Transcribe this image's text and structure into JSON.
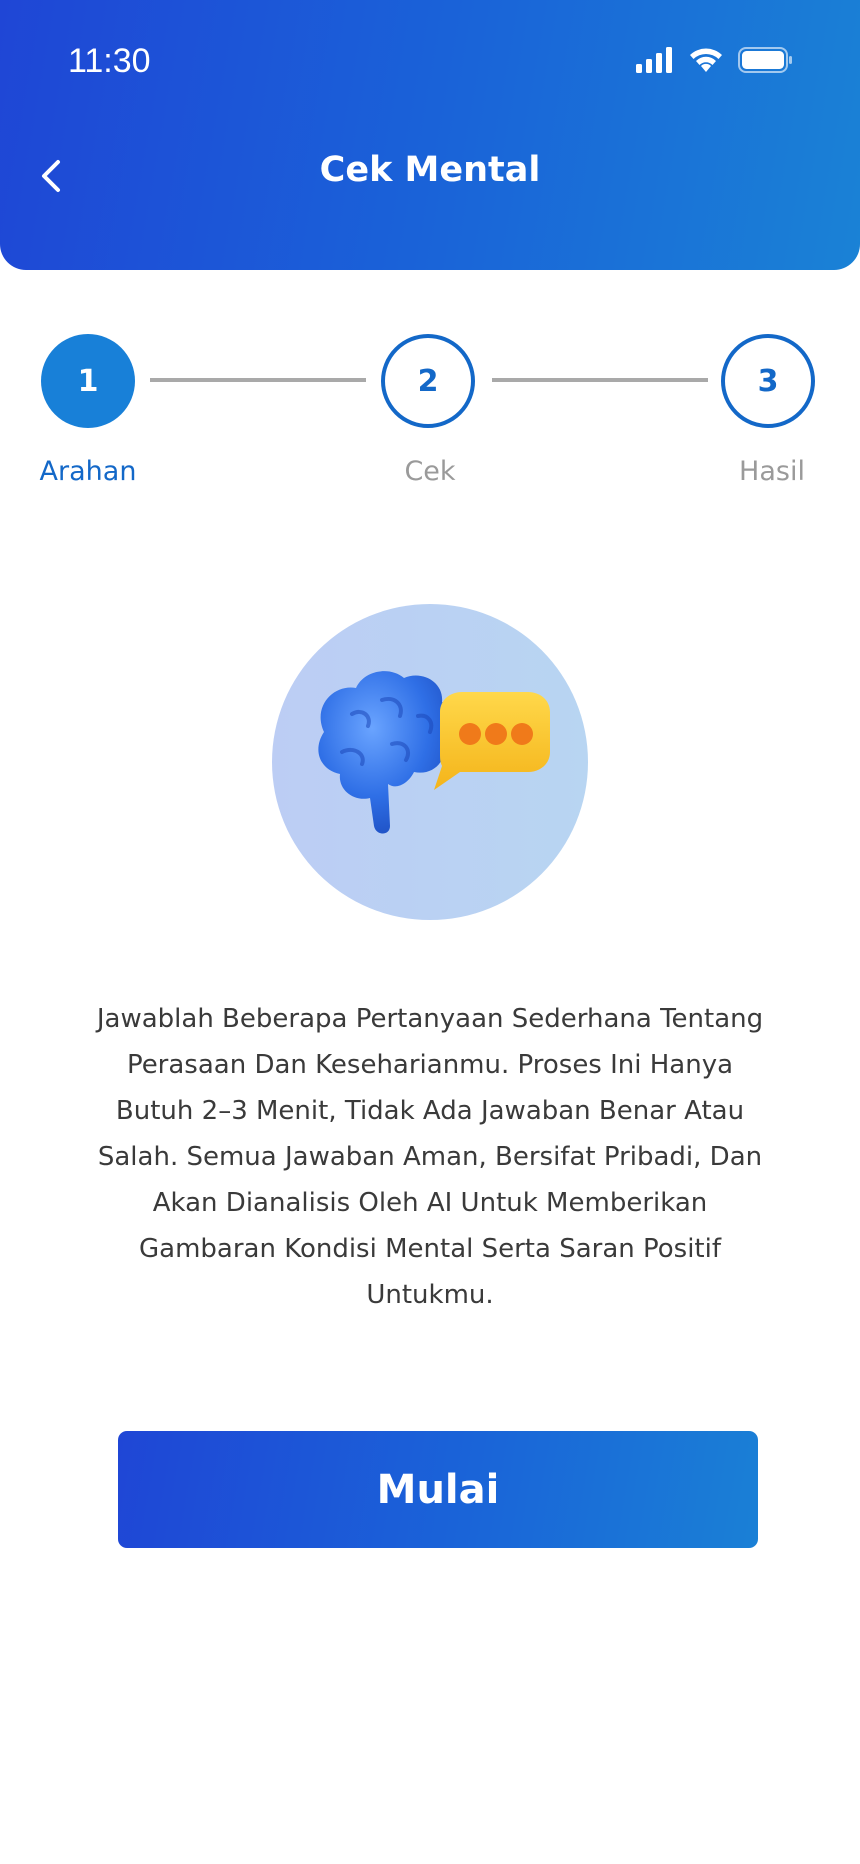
{
  "status_bar": {
    "time": "11:30"
  },
  "header": {
    "title": "Cek Mental"
  },
  "stepper": {
    "steps": [
      {
        "number": "1",
        "label": "Arahan",
        "state": "active"
      },
      {
        "number": "2",
        "label": "Cek",
        "state": "inactive"
      },
      {
        "number": "3",
        "label": "Hasil",
        "state": "inactive"
      }
    ]
  },
  "illustration": {
    "icon": "brain-chat-icon"
  },
  "description": "Jawablah Beberapa Pertanyaan Sederhana Tentang Perasaan Dan Kesehari­anmu. Proses Ini Hanya Butuh 2–3 Menit, Tidak Ada Jawaban Benar Atau Salah. Semua Jawaban Aman, Bersifat Pribadi, Dan Akan Dianalisis Oleh AI Untuk Memberikan Gambaran Kondisi Mental Serta Saran Positif Untukmu.",
  "actions": {
    "start_label": "Mulai"
  },
  "colors": {
    "primary": "#1f46d6",
    "accent": "#1880d8",
    "step_active_text": "#1368c8",
    "step_inactive_text": "#9a9a9a"
  }
}
